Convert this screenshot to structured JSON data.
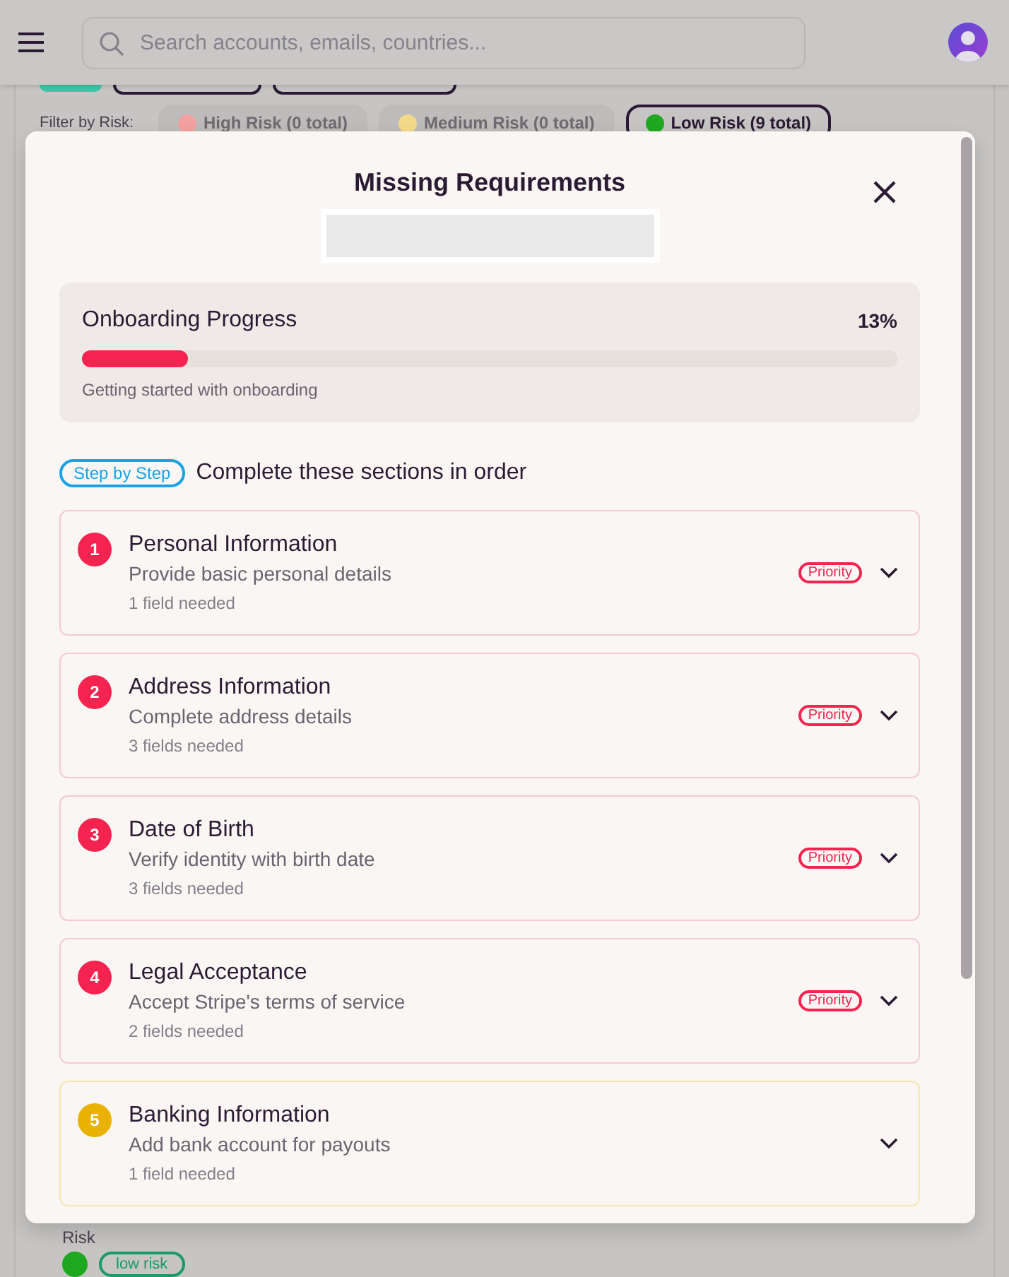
{
  "header": {
    "search": {
      "placeholder": "Search accounts, emails, countries..."
    }
  },
  "filter": {
    "label": "Filter by Risk:",
    "chips": [
      {
        "label": "High Risk (0 total)",
        "selected": false,
        "color": "#f3a0a0"
      },
      {
        "label": "Medium Risk (0 total)",
        "selected": false,
        "color": "#f2d98a"
      },
      {
        "label": "Low Risk (9 total)",
        "selected": true,
        "color": "#1fa81f"
      }
    ]
  },
  "background_row": {
    "label": "Risk",
    "badge": "low risk"
  },
  "modal": {
    "title": "Missing Requirements",
    "progress": {
      "title": "Onboarding Progress",
      "percent": "13%",
      "level": 0.13,
      "caption": "Getting started with onboarding"
    },
    "intro": {
      "badge": "Step by Step",
      "text": "Complete these sections in order"
    },
    "sections": [
      {
        "number": "1",
        "title": "Personal Information",
        "description": "Provide basic personal details",
        "needed": "1 field needed",
        "priority": true,
        "badge": "Priority",
        "color": "#f5234f",
        "expanded": false
      },
      {
        "number": "2",
        "title": "Address Information",
        "description": "Complete address details",
        "needed": "3 fields needed",
        "priority": true,
        "badge": "Priority",
        "color": "#f5234f",
        "expanded": false
      },
      {
        "number": "3",
        "title": "Date of Birth",
        "description": "Verify identity with birth date",
        "needed": "3 fields needed",
        "priority": true,
        "badge": "Priority",
        "color": "#f5234f",
        "expanded": false
      },
      {
        "number": "4",
        "title": "Legal Acceptance",
        "description": "Accept Stripe's terms of service",
        "needed": "2 fields needed",
        "priority": true,
        "badge": "Priority",
        "color": "#f5234f",
        "expanded": false
      },
      {
        "number": "5",
        "title": "Banking Information",
        "description": "Add bank account for payouts",
        "needed": "1 field needed",
        "priority": false,
        "color": "#e9b100",
        "expanded": false
      }
    ]
  }
}
